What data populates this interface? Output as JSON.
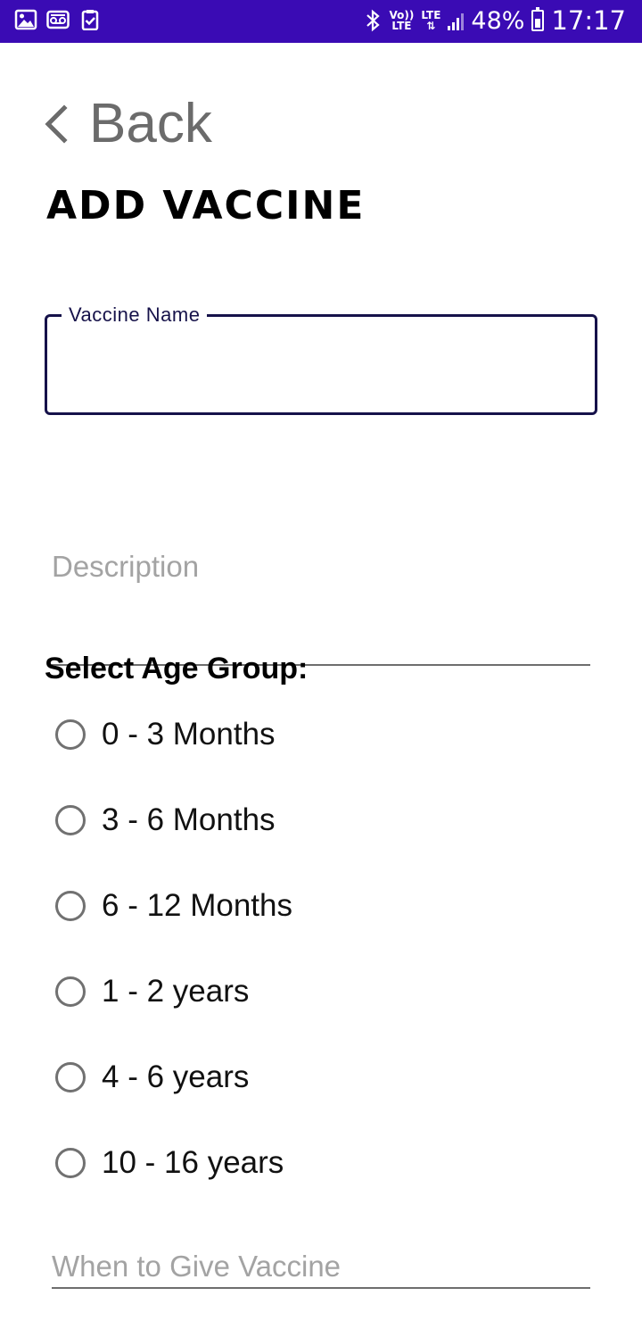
{
  "status_bar": {
    "icons_left": [
      "gallery-icon",
      "voicemail-icon",
      "clipboard-check-icon"
    ],
    "volte": "Vo))",
    "volte_sub": "LTE",
    "network": "LTE",
    "battery_percent": "48%",
    "time": "17:17",
    "background_color": "#3a0bb4"
  },
  "header": {
    "back_label": "Back",
    "title": "Add Vaccine"
  },
  "form": {
    "vaccine_name": {
      "label": "Vaccine Name",
      "value": ""
    },
    "description": {
      "placeholder": "Description",
      "value": ""
    },
    "age_group": {
      "label": "Select Age Group:",
      "options": [
        {
          "label": "0 - 3 Months",
          "selected": false
        },
        {
          "label": "3 - 6 Months",
          "selected": false
        },
        {
          "label": "6 - 12 Months",
          "selected": false
        },
        {
          "label": "1 - 2 years",
          "selected": false
        },
        {
          "label": "4 - 6 years",
          "selected": false
        },
        {
          "label": "10 - 16 years",
          "selected": false
        }
      ]
    },
    "when_to_give": {
      "placeholder": "When to Give Vaccine",
      "value": ""
    }
  },
  "colors": {
    "accent_border": "#16124a",
    "placeholder": "#a3a3a3",
    "back_text": "#6b6b6b"
  }
}
